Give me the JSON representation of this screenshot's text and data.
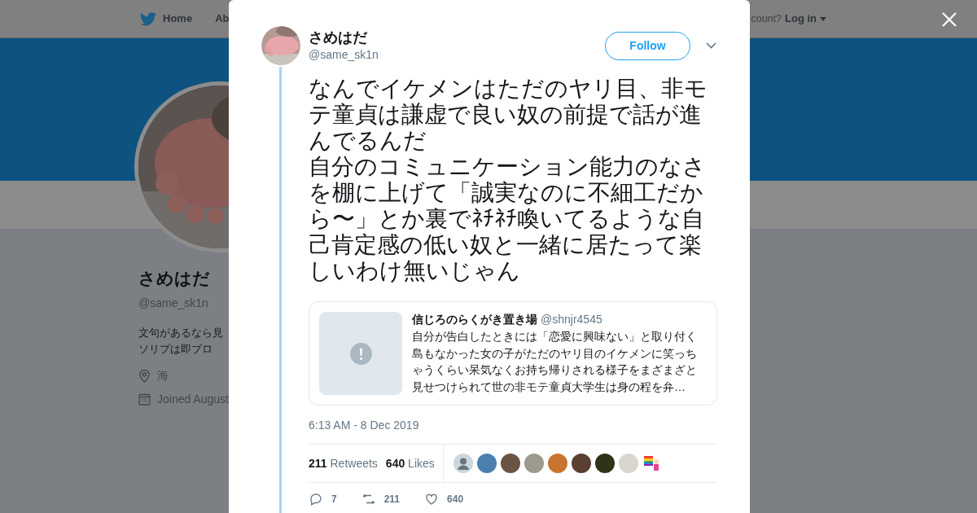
{
  "nav": {
    "items": [
      "Home",
      "Ab"
    ],
    "account_prompt": "count?",
    "login": "Log in"
  },
  "profile": {
    "name": "さめはだ",
    "handle": "@same_sk1n",
    "bio_lines": [
      "文句があるなら見",
      "ソリプは即ブロ"
    ],
    "location": "海",
    "joined": "Joined August"
  },
  "tweet": {
    "name": "さめはだ",
    "handle": "@same_sk1n",
    "follow": "Follow",
    "text_paragraphs": [
      "なんでイケメンはただのヤリ目、非モテ童貞は謙虚で良い奴の前提で話が進んでるんだ",
      "自分のコミュニケーション能力のなさを棚に上げて「誠実なのに不細工だから〜」とか裏でﾈﾁﾈﾁ喚いてるような自己肯定感の低い奴と一緒に居たって楽しいわけ無いじゃん"
    ],
    "quote": {
      "name": "信じろのらくがき置き場",
      "handle": "@shnjr4545",
      "text": "自分が告白したときには「恋愛に興味ない」と取り付く島もなかった女の子がただのヤリ目のイケメンに笑っちゃうくらい呆気なくお持ち帰りされる様子をまざまざと見せつけられて世の非モテ童貞大学生は身の程を弁…"
    },
    "time": "6:13 AM - 8 Dec 2019",
    "stats": [
      {
        "count": "211",
        "label": "Retweets"
      },
      {
        "count": "640",
        "label": "Likes"
      }
    ],
    "likers": [
      {
        "kind": "default"
      },
      {
        "kind": "picture",
        "color": "#4a7fb0"
      },
      {
        "kind": "picture",
        "color": "#6b5444"
      },
      {
        "kind": "picture",
        "color": "#9c9a8e"
      },
      {
        "kind": "picture",
        "color": "#c9742e"
      },
      {
        "kind": "picture",
        "color": "#5a3f33"
      },
      {
        "kind": "picture",
        "color": "#2f3318"
      },
      {
        "kind": "picture",
        "color": "#d9d6d0"
      },
      {
        "kind": "flag"
      }
    ],
    "actions": [
      {
        "kind": "reply",
        "count": "7"
      },
      {
        "kind": "retweet",
        "count": "211"
      },
      {
        "kind": "like",
        "count": "640"
      }
    ]
  }
}
